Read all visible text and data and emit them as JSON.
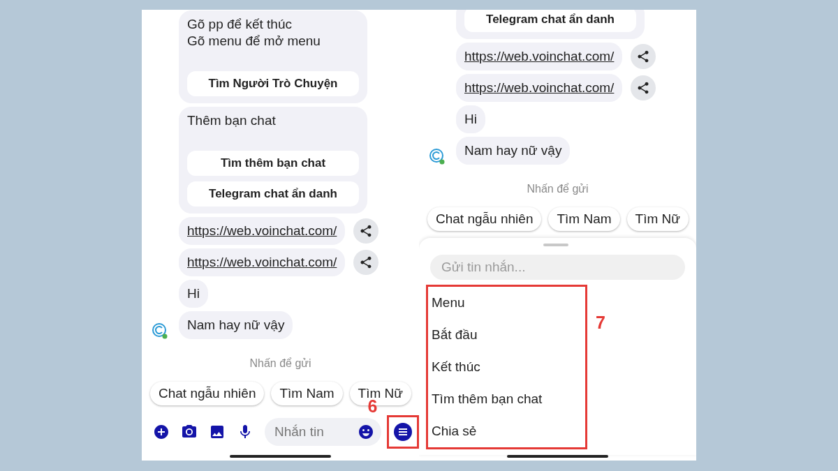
{
  "left_screen": {
    "messages": [
      {
        "kind": "card",
        "text": "Gõ pp để kết thúc\nGõ menu để mở menu",
        "buttons": [
          "Tìm Người Trò Chuyện"
        ]
      },
      {
        "kind": "card",
        "text": "Thêm bạn chat",
        "buttons": [
          "Tìm thêm bạn chat",
          "Telegram chat ẩn danh"
        ]
      },
      {
        "kind": "link",
        "text": "https://web.voinchat.com/",
        "show_avatar": false
      },
      {
        "kind": "link",
        "text": "https://web.voinchat.com/",
        "show_avatar": false
      },
      {
        "kind": "text",
        "text": "Hi",
        "show_avatar": false
      },
      {
        "kind": "text",
        "text": "Nam hay nữ vậy",
        "show_avatar": true
      }
    ],
    "send_hint": "Nhấn để gửi",
    "quick_replies": [
      "Chat ngẫu nhiên",
      "Tìm Nam",
      "Tìm Nữ"
    ],
    "composer": {
      "placeholder": "Nhắn tin"
    },
    "callout": "6"
  },
  "right_screen": {
    "messages": [
      {
        "kind": "card",
        "buttons": [
          "Telegram chat ẩn danh"
        ]
      },
      {
        "kind": "link",
        "text": "https://web.voinchat.com/",
        "show_avatar": false
      },
      {
        "kind": "link",
        "text": "https://web.voinchat.com/",
        "show_avatar": false
      },
      {
        "kind": "text",
        "text": "Hi",
        "show_avatar": false
      },
      {
        "kind": "text",
        "text": "Nam hay nữ vậy",
        "show_avatar": true
      }
    ],
    "send_hint": "Nhấn để gửi",
    "quick_replies": [
      "Chat ngẫu nhiên",
      "Tìm Nam",
      "Tìm Nữ"
    ],
    "sheet": {
      "placeholder": "Gửi tin nhắn...",
      "menu_items": [
        "Menu",
        "Bắt đầu",
        "Kết thúc",
        "Tìm thêm bạn chat",
        "Chia sẻ"
      ]
    },
    "callout": "7"
  }
}
